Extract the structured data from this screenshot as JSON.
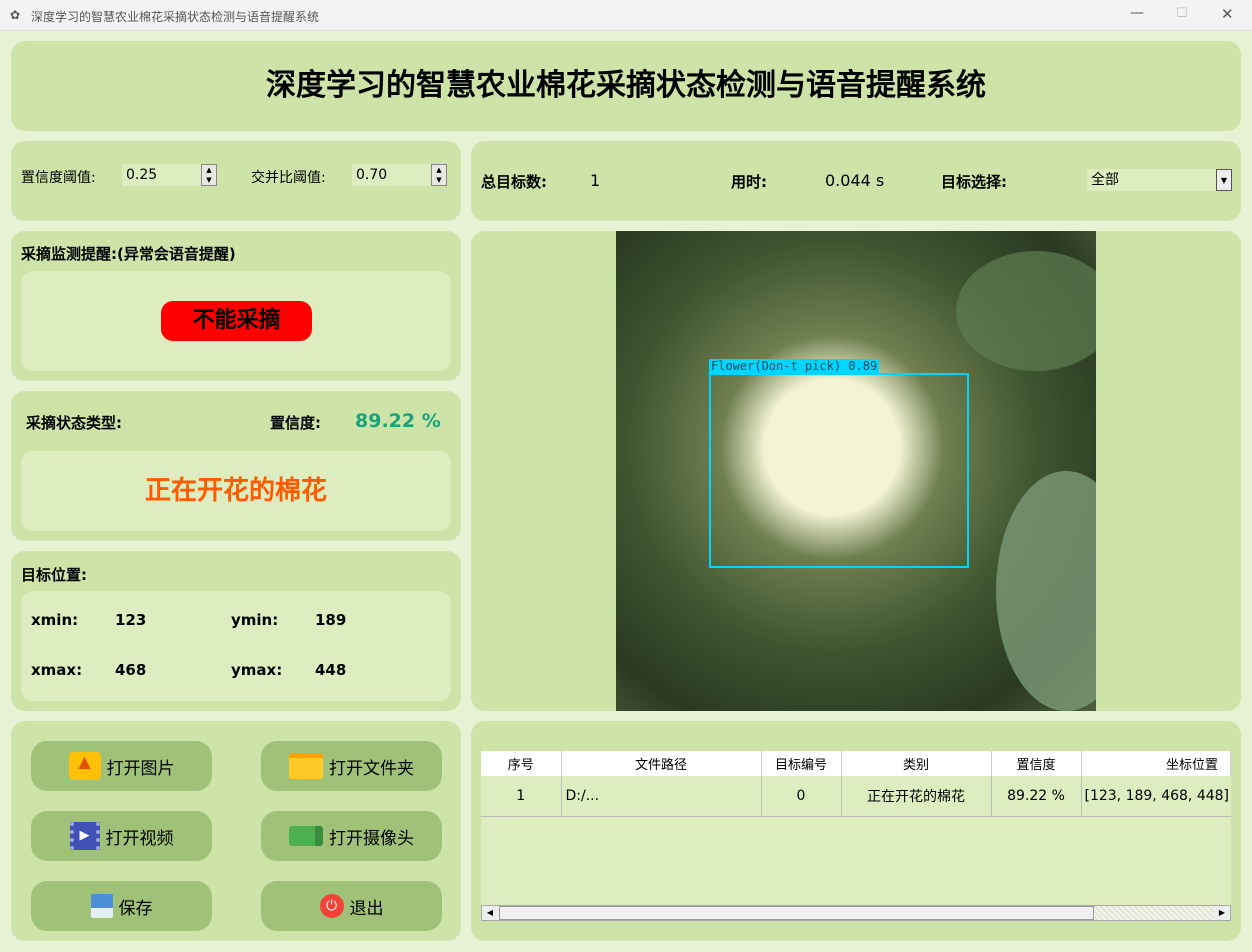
{
  "window": {
    "title": "深度学习的智慧农业棉花采摘状态检测与语音提醒系统"
  },
  "header": {
    "title": "深度学习的智慧农业棉花采摘状态检测与语音提醒系统"
  },
  "params": {
    "conf_label": "置信度阈值:",
    "conf_value": "0.25",
    "iou_label": "交并比阈值:",
    "iou_value": "0.70"
  },
  "stats": {
    "total_label": "总目标数:",
    "total_value": "1",
    "time_label": "用时:",
    "time_value": "0.044 s",
    "select_label": "目标选择:",
    "select_value": "全部"
  },
  "alert": {
    "label": "采摘监测提醒:(异常会语音提醒)",
    "badge": "不能采摘",
    "badge_color": "#ff0000"
  },
  "type": {
    "label": "采摘状态类型:",
    "conf_label": "置信度:",
    "conf_value": "89.22 %",
    "class_value": "正在开花的棉花"
  },
  "position": {
    "label": "目标位置:",
    "xmin_label": "xmin:",
    "xmin": "123",
    "ymin_label": "ymin:",
    "ymin": "189",
    "xmax_label": "xmax:",
    "xmax": "468",
    "ymax_label": "ymax:",
    "ymax": "448"
  },
  "detection": {
    "box_label": "Flower(Don-t pick) 0.89",
    "box_color": "#00d5ff"
  },
  "buttons": {
    "open_image": "打开图片",
    "open_folder": "打开文件夹",
    "open_video": "打开视频",
    "open_camera": "打开摄像头",
    "save": "保存",
    "exit": "退出"
  },
  "table": {
    "headers": [
      "序号",
      "文件路径",
      "目标编号",
      "类别",
      "置信度",
      "坐标位置"
    ],
    "rows": [
      [
        "1",
        "D:/...",
        "0",
        "正在开花的棉花",
        "89.22 %",
        "[123, 189, 468, 448]"
      ]
    ]
  }
}
